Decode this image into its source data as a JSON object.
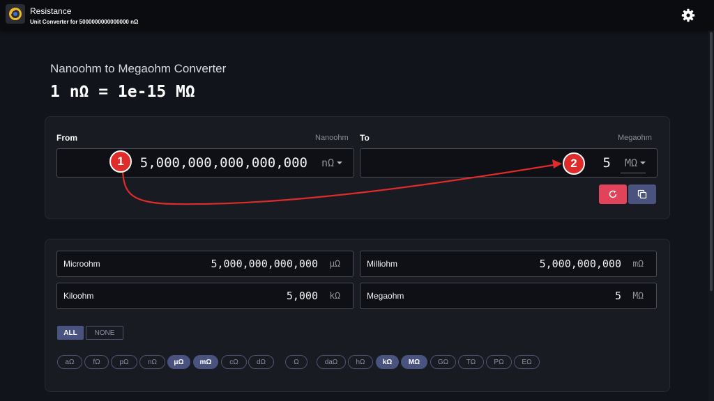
{
  "header": {
    "title": "Resistance",
    "subtitle": "Unit Converter for 5000000000000000 nΩ"
  },
  "page": {
    "subtitle": "Nanoohm to Megaohm Converter",
    "equation": "1 nΩ = 1e-15 MΩ"
  },
  "converter": {
    "from_label": "From",
    "from_unit_name": "Nanoohm",
    "from_value": "5,000,000,000,000,000",
    "from_symbol": "nΩ",
    "to_label": "To",
    "to_unit_name": "Megaohm",
    "to_value": "5",
    "to_symbol": "MΩ"
  },
  "annotations": {
    "marker1": "1",
    "marker2": "2"
  },
  "results": [
    {
      "name": "Microohm",
      "value": "5,000,000,000,000",
      "symbol": "μΩ"
    },
    {
      "name": "Milliohm",
      "value": "5,000,000,000",
      "symbol": "mΩ"
    },
    {
      "name": "Kiloohm",
      "value": "5,000",
      "symbol": "kΩ"
    },
    {
      "name": "Megaohm",
      "value": "5",
      "symbol": "MΩ"
    }
  ],
  "selection": {
    "all": "ALL",
    "none": "NONE"
  },
  "chips": [
    {
      "label": "aΩ",
      "selected": false
    },
    {
      "label": "fΩ",
      "selected": false
    },
    {
      "label": "pΩ",
      "selected": false
    },
    {
      "label": "nΩ",
      "selected": false
    },
    {
      "label": "μΩ",
      "selected": true
    },
    {
      "label": "mΩ",
      "selected": true
    },
    {
      "label": "cΩ",
      "selected": false
    },
    {
      "label": "dΩ",
      "selected": false
    },
    {
      "label": "Ω",
      "selected": false
    },
    {
      "label": "daΩ",
      "selected": false
    },
    {
      "label": "hΩ",
      "selected": false
    },
    {
      "label": "kΩ",
      "selected": true
    },
    {
      "label": "MΩ",
      "selected": true
    },
    {
      "label": "GΩ",
      "selected": false
    },
    {
      "label": "TΩ",
      "selected": false
    },
    {
      "label": "PΩ",
      "selected": false
    },
    {
      "label": "EΩ",
      "selected": false
    }
  ],
  "colors": {
    "reset_button": "#e0435a",
    "copy_button": "#4a5380",
    "marker": "#e02b2b",
    "arrow": "#e02b2b"
  },
  "icons": {
    "app": "resistance-logo",
    "settings": "gear-icon",
    "reset": "refresh-icon",
    "copy": "copy-icon"
  }
}
